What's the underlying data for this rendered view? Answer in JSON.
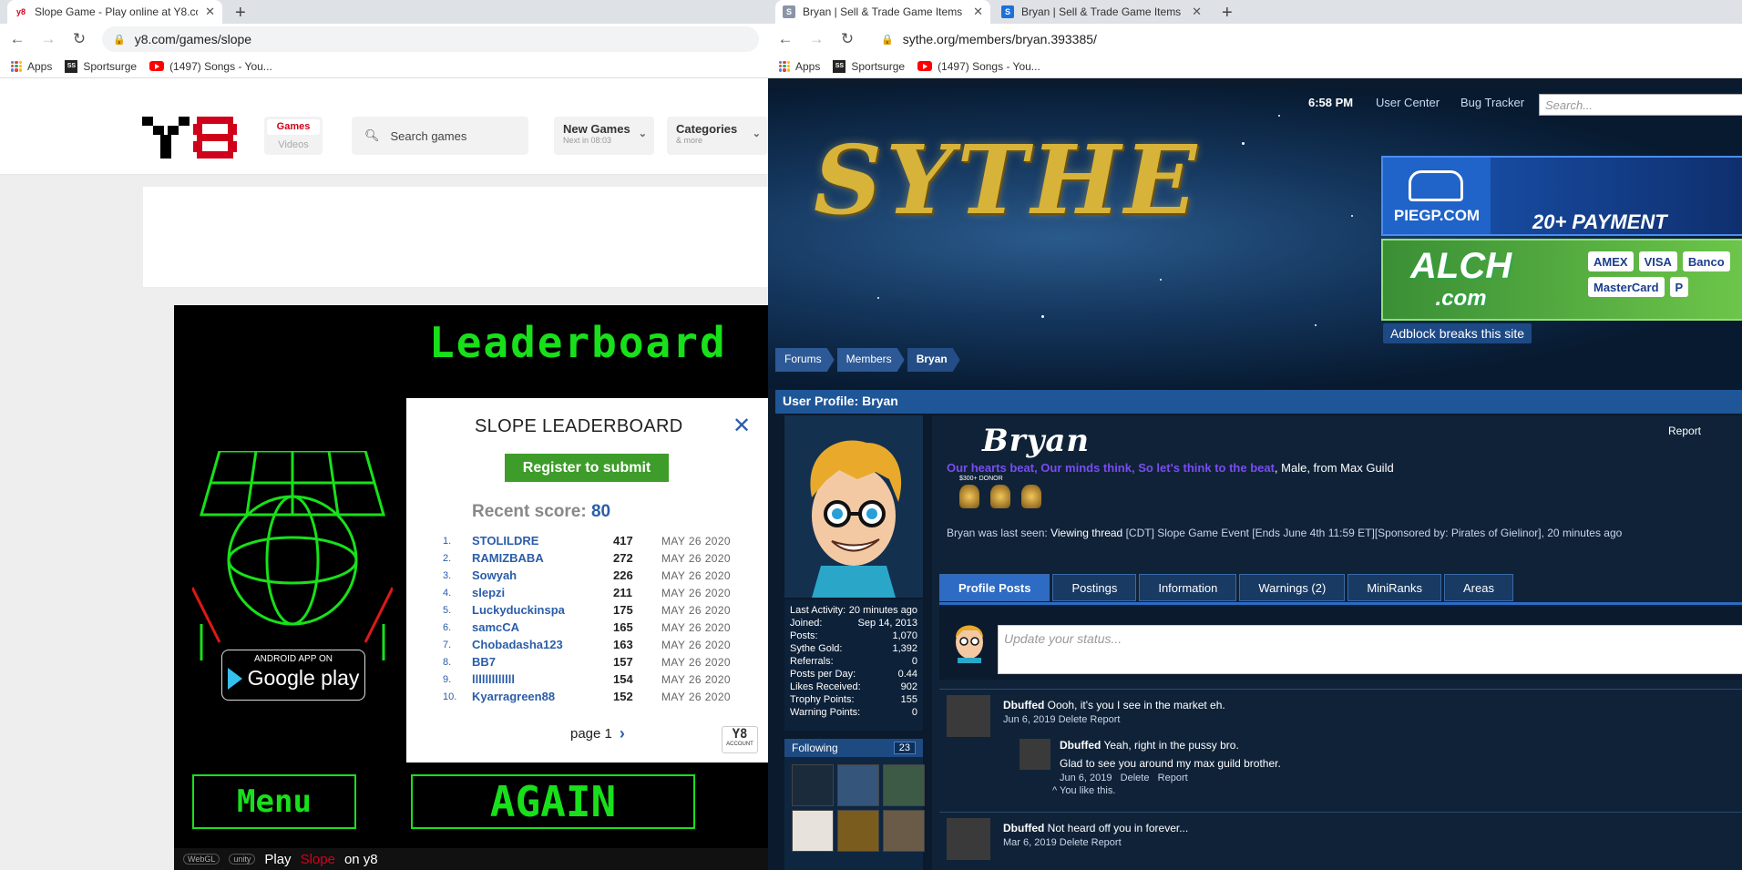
{
  "left_browser": {
    "tab_title": "Slope Game - Play online at Y8.co",
    "url": "y8.com/games/slope",
    "bookmarks": [
      "Apps",
      "Sportsurge",
      "(1497) Songs - You..."
    ]
  },
  "y8": {
    "logo": "Y8",
    "nav_games": "Games",
    "nav_videos": "Videos",
    "search_placeholder": "Search games",
    "new_games": "New Games",
    "new_games_sub": "Next in 08:03",
    "categories": "Categories",
    "categories_sub": "& more"
  },
  "game": {
    "title": "Leaderboard",
    "android_line1": "ANDROID APP ON",
    "android_line2": "Google play",
    "menu_button": "Menu",
    "again_button": "AGAIN",
    "bottom_prefix": "Play",
    "bottom_game": "Slope",
    "bottom_suffix": "on y8",
    "webgl": "WebGL",
    "unity": "unity"
  },
  "leaderboard": {
    "heading": "SLOPE LEADERBOARD",
    "register": "Register to submit",
    "recent_label": "Recent score:",
    "recent_value": "80",
    "rows": [
      {
        "rank": "1.",
        "name": "STOLILDRE",
        "score": "417",
        "date": "MAY 26 2020"
      },
      {
        "rank": "2.",
        "name": "RAMIZBABA",
        "score": "272",
        "date": "MAY 26 2020"
      },
      {
        "rank": "3.",
        "name": "Sowyah",
        "score": "226",
        "date": "MAY 26 2020"
      },
      {
        "rank": "4.",
        "name": "slepzi",
        "score": "211",
        "date": "MAY 26 2020"
      },
      {
        "rank": "5.",
        "name": "Luckyduckinspa",
        "score": "175",
        "date": "MAY 26 2020"
      },
      {
        "rank": "6.",
        "name": "samcCA",
        "score": "165",
        "date": "MAY 26 2020"
      },
      {
        "rank": "7.",
        "name": "Chobadasha123",
        "score": "163",
        "date": "MAY 26 2020"
      },
      {
        "rank": "8.",
        "name": "BB7",
        "score": "157",
        "date": "MAY 26 2020"
      },
      {
        "rank": "9.",
        "name": "lllllllllllll",
        "score": "154",
        "date": "MAY 26 2020"
      },
      {
        "rank": "10.",
        "name": "Kyarragreen88",
        "score": "152",
        "date": "MAY 26 2020"
      }
    ],
    "page_label": "page 1",
    "account_logo": "Y8",
    "account_label": "ACCOUNT"
  },
  "right_browser": {
    "tab1_title": "Bryan | Sell & Trade Game Items",
    "tab2_title": "Bryan | Sell & Trade Game Items",
    "url": "sythe.org/members/bryan.393385/",
    "bookmarks": [
      "Apps",
      "Sportsurge",
      "(1497) Songs - You..."
    ]
  },
  "sythe": {
    "logo": "SYTHE",
    "time": "6:58 PM",
    "user_center": "User Center",
    "bug_tracker": "Bug Tracker",
    "search_placeholder": "Search...",
    "ad1_brand": "PIEGP.COM",
    "ad1_text": "20+ PAYMENT",
    "ad2_brand": "ALCH",
    "ad2_sub": ".com",
    "ad2_cards": [
      "AMEX",
      "VISA",
      "Banco",
      "MasterCard",
      "P"
    ],
    "adblock": "Adblock breaks this site",
    "breadcrumbs": [
      "Forums",
      "Members",
      "Bryan"
    ],
    "profile_header": "User Profile: Bryan",
    "username": "Bryan",
    "report": "Report",
    "motto": "Our hearts beat, Our minds think, So let's think to the beat",
    "motto_suffix": ", Male, from ",
    "guild": "Max Guild",
    "donor_badge": "$300+ DONOR",
    "last_seen_label": "Bryan was last seen:",
    "last_seen_action": "Viewing thread",
    "last_seen_thread": "[CDT] Slope Game Event [Ends June 4th 11:59 ET][Sponsored by: Pirates of Gielinor], 20 minutes ago",
    "stats": [
      {
        "label": "Last Activity:",
        "value": "20 minutes ago"
      },
      {
        "label": "Joined:",
        "value": "Sep 14, 2013"
      },
      {
        "label": "Posts:",
        "value": "1,070"
      },
      {
        "label": "Sythe Gold:",
        "value": "1,392"
      },
      {
        "label": "Referrals:",
        "value": "0"
      },
      {
        "label": "Posts per Day:",
        "value": "0.44"
      },
      {
        "label": "Likes Received:",
        "value": "902"
      },
      {
        "label": "Trophy Points:",
        "value": "155"
      },
      {
        "label": "Warning Points:",
        "value": "0"
      }
    ],
    "following_label": "Following",
    "following_count": "23",
    "tabs": [
      "Profile Posts",
      "Postings",
      "Information",
      "Warnings (2)",
      "MiniRanks",
      "Areas"
    ],
    "status_placeholder": "Update your status...",
    "post1_author": "Dbuffed",
    "post1_text": "Oooh, it's you I see in the market eh.",
    "post1_date": "Jun 6, 2019",
    "post1_actions": "Delete Report",
    "reply_author": "Dbuffed",
    "reply_text": "Yeah, right in the pussy bro.",
    "reply_text2": "Glad to see you around my max guild brother.",
    "reply_date": "Jun 6, 2019",
    "reply_delete": "Delete",
    "reply_report": "Report",
    "reply_like": "^ You like this.",
    "post2_author": "Dbuffed",
    "post2_text": "Not heard off you in forever...",
    "post2_date": "Mar 6, 2019",
    "post2_actions": "Delete Report"
  }
}
